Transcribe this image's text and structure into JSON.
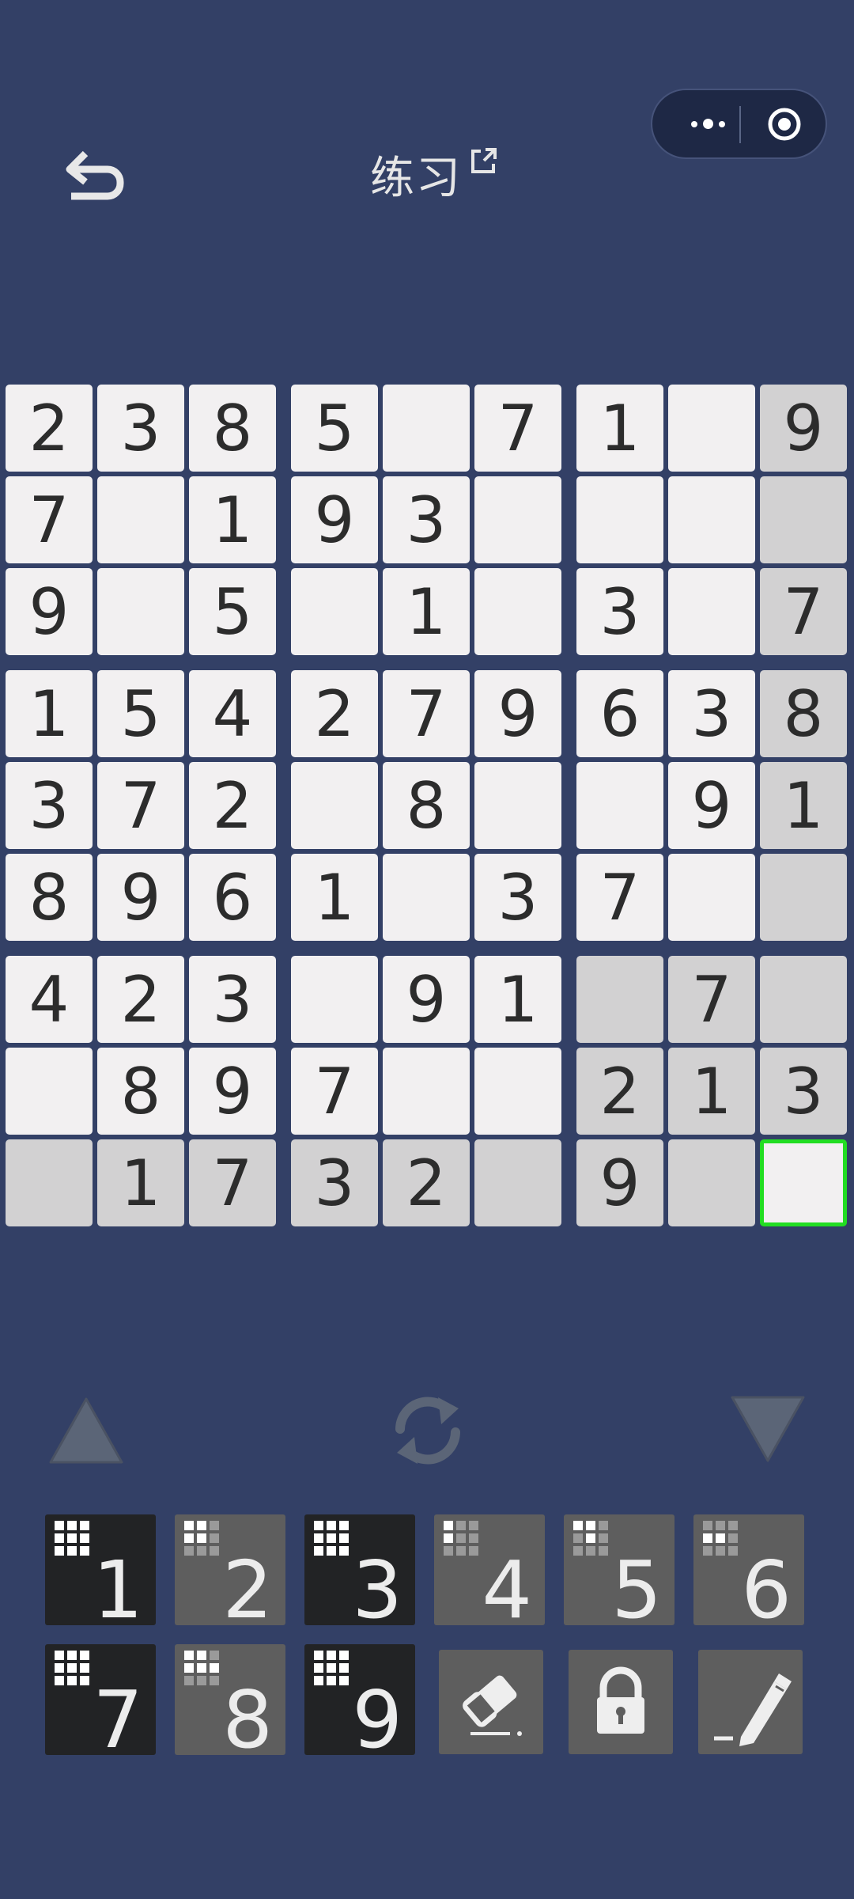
{
  "header": {
    "title": "练习"
  },
  "capsule": {
    "more_icon": "more-dots-icon",
    "close_icon": "target-circle-icon"
  },
  "board": {
    "rows": [
      [
        "2",
        "3",
        "8",
        "5",
        "",
        "7",
        "1",
        "",
        "9"
      ],
      [
        "7",
        "",
        "1",
        "9",
        "3",
        "",
        "",
        "",
        ""
      ],
      [
        "9",
        "",
        "5",
        "",
        "1",
        "",
        "3",
        "",
        "7"
      ],
      [
        "1",
        "5",
        "4",
        "2",
        "7",
        "9",
        "6",
        "3",
        "8"
      ],
      [
        "3",
        "7",
        "2",
        "",
        "8",
        "",
        "",
        "9",
        "1"
      ],
      [
        "8",
        "9",
        "6",
        "1",
        "",
        "3",
        "7",
        "",
        ""
      ],
      [
        "4",
        "2",
        "3",
        "",
        "9",
        "1",
        "",
        "7",
        ""
      ],
      [
        "",
        "8",
        "9",
        "7",
        "",
        "",
        "2",
        "1",
        "3"
      ],
      [
        "",
        "1",
        "7",
        "3",
        "2",
        "",
        "9",
        "",
        ""
      ]
    ],
    "highlight_color": "#d2d1d2",
    "selected": {
      "row": 9,
      "col": 9
    },
    "selected_border_color": "#22dd22"
  },
  "controls": {
    "up_icon": "triangle-up-icon",
    "refresh_icon": "refresh-icon",
    "down_icon": "triangle-down-icon"
  },
  "keypad": {
    "numbers": [
      {
        "label": "1",
        "style": "dark",
        "pattern": [
          1,
          1,
          1,
          1,
          1,
          1,
          1,
          1,
          1
        ]
      },
      {
        "label": "2",
        "style": "gray",
        "pattern": [
          1,
          1,
          0,
          1,
          1,
          0,
          0,
          0,
          0
        ]
      },
      {
        "label": "3",
        "style": "dark",
        "pattern": [
          1,
          1,
          1,
          1,
          1,
          1,
          1,
          1,
          1
        ]
      },
      {
        "label": "4",
        "style": "gray",
        "pattern": [
          1,
          0,
          0,
          1,
          0,
          0,
          0,
          0,
          0
        ]
      },
      {
        "label": "5",
        "style": "gray",
        "pattern": [
          1,
          1,
          0,
          0,
          1,
          0,
          0,
          0,
          0
        ]
      },
      {
        "label": "6",
        "style": "gray",
        "pattern": [
          0,
          0,
          0,
          1,
          1,
          0,
          0,
          0,
          0
        ]
      },
      {
        "label": "7",
        "style": "dark",
        "pattern": [
          1,
          1,
          1,
          1,
          1,
          1,
          1,
          1,
          1
        ]
      },
      {
        "label": "8",
        "style": "gray",
        "pattern": [
          1,
          1,
          0,
          1,
          1,
          1,
          0,
          0,
          0
        ]
      },
      {
        "label": "9",
        "style": "dark",
        "pattern": [
          1,
          1,
          1,
          1,
          1,
          1,
          1,
          1,
          1
        ]
      }
    ],
    "tools": [
      "eraser-icon",
      "lock-icon",
      "pencil-icon"
    ]
  }
}
